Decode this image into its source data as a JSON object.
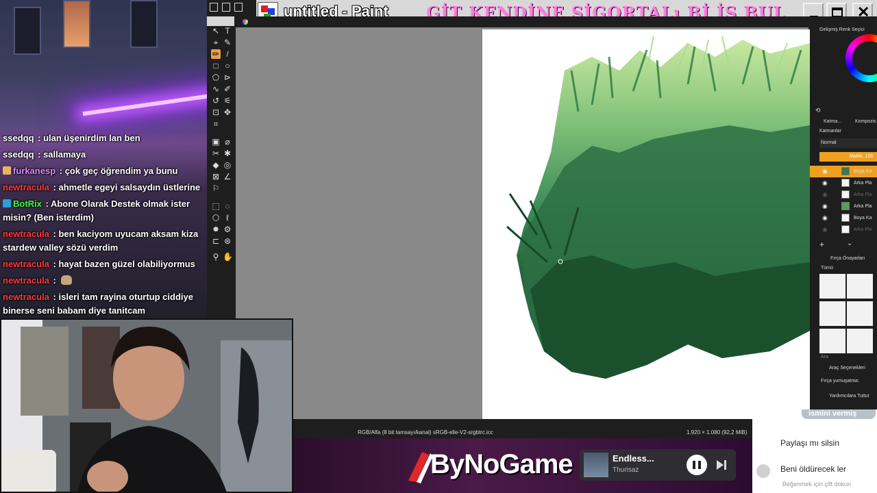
{
  "chat": {
    "messages": [
      {
        "user": "ssedqq",
        "sep": " : ",
        "text": "ulan üşenirdim lan ben",
        "color": "#ffffff",
        "badge": ""
      },
      {
        "user": "ssedqq",
        "sep": " : ",
        "text": "sallamaya",
        "color": "#ffffff",
        "badge": ""
      },
      {
        "user": "furkanesp",
        "sep": " : ",
        "text": "çok geç öğrendim ya bunu",
        "color": "#d889ff",
        "badge": "#e8b75a"
      },
      {
        "user": "newtracula",
        "sep": " : ",
        "text": "ahmetle egeyi salsaydın üstlerine",
        "color": "#ff3a3a",
        "badge": ""
      },
      {
        "user": "BotRix",
        "sep": " : ",
        "text": "Abone Olarak Destek olmak ister misin? (Ben isterdim)",
        "color": "#3aff3a",
        "badge": "#2aa0d8"
      },
      {
        "user": "newtracula",
        "sep": " : ",
        "text": "ben kaciyom uyucam aksam kiza stardew valley sözü verdim",
        "color": "#ff3a3a",
        "badge": ""
      },
      {
        "user": "newtracula",
        "sep": " : ",
        "text": "hayat bazen güzel olabiliyormus",
        "color": "#ff3a3a",
        "badge": ""
      },
      {
        "user": "newtracula",
        "sep": " : ",
        "text": "",
        "color": "#ff3a3a",
        "badge": "",
        "emote": "cat-emote"
      },
      {
        "user": "newtracula",
        "sep": " : ",
        "text": "isleri tam rayina oturtup ciddiye binerse seni babam diye tanitcam",
        "color": "#ff3a3a",
        "badge": ""
      }
    ]
  },
  "paint": {
    "title": "untitled - Paint",
    "banner": "GİT KENDİNE SİGORTALı Bİ İŞ BUL",
    "status_color": "RGB/Alfa (8 bit tamsayı/kanal) sRGB-elle-V2-srgbtrc.icc",
    "status_size": "1.920 × 1.080 (92,2 MiB)"
  },
  "panel": {
    "color_selector": "Gelişmiş Renk Seçici",
    "tab_layers": "Katma...",
    "tab_compo": "Kompozis",
    "layers_title": "Katmanlar",
    "blend_mode": "Normal",
    "opacity": "Matlık: 100",
    "layers": [
      {
        "name": "Boya Ka",
        "visible": true,
        "active": true
      },
      {
        "name": "Arka Pla",
        "visible": true,
        "active": false
      },
      {
        "name": "Arka Pla",
        "visible": false,
        "active": false
      },
      {
        "name": "Arka Pla",
        "visible": true,
        "active": false
      },
      {
        "name": "Boya Ka",
        "visible": true,
        "active": false
      },
      {
        "name": "Arka Pla",
        "visible": false,
        "active": false
      }
    ],
    "brush_presets": "Fırça Önayarları",
    "brush_filter": "Tümü",
    "search": "Ara",
    "tool_options": "Araç Seçenekleri",
    "brush_smoothing": "Fırça yumuşatma:",
    "assist_button": "Yardımcılara Tuttur"
  },
  "overlay": {
    "brand": "ByNoGame",
    "track_title": "Endless...",
    "track_artist": "Thurisaz"
  },
  "comments": {
    "pill": "ismini vermiş",
    "items": [
      "Paylaşı mı silsin",
      "Beni öldürecek ler"
    ],
    "hint": "Beğenmek için çift dokun"
  }
}
